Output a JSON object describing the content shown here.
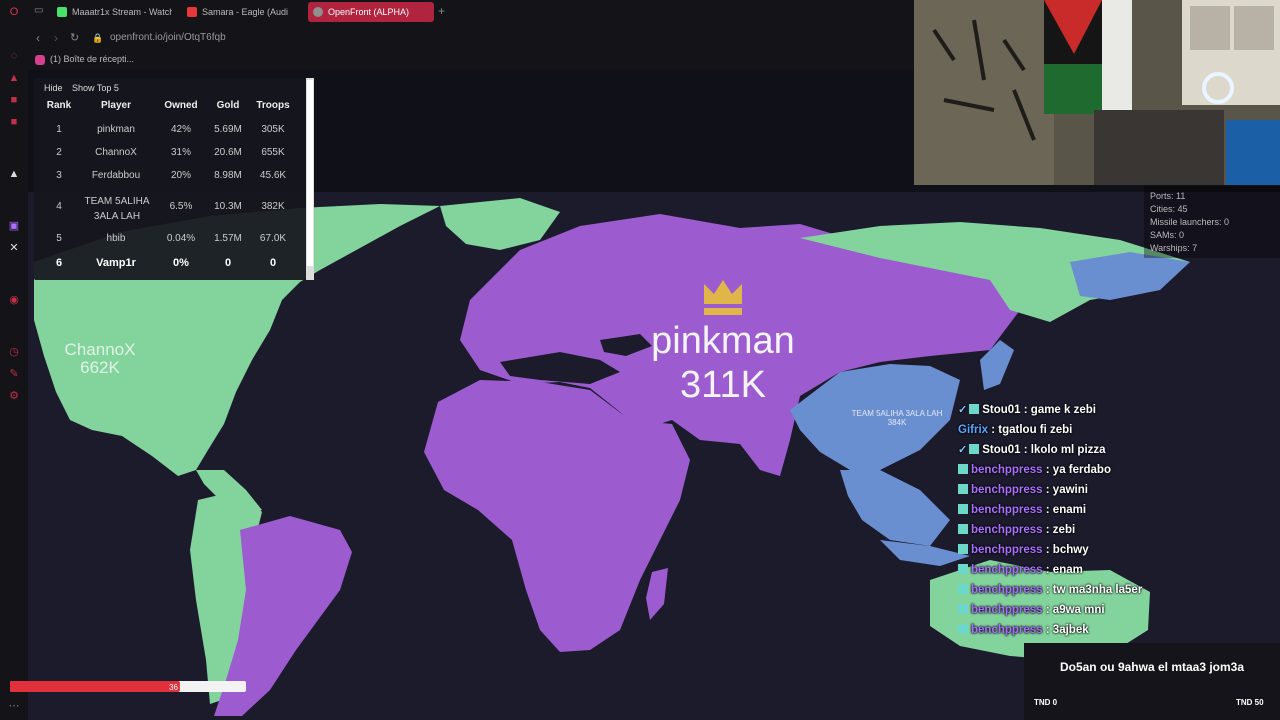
{
  "browser": {
    "tabs": [
      {
        "label": "Maaatr1x Stream - Watch",
        "icon_color": "#46e26a"
      },
      {
        "label": "Samara - Eagle (Audi",
        "icon_color": "#e53939"
      },
      {
        "label": "OpenFront (ALPHA)",
        "icon_color": "#8f8f8f"
      }
    ],
    "url": "openfront.io/join/OtqT6fqb",
    "bookmark": "(1) Boîte de récepti..."
  },
  "leaderboard": {
    "hide_label": "Hide",
    "show_top_label": "Show Top 5",
    "columns": [
      "Rank",
      "Player",
      "Owned",
      "Gold",
      "Troops"
    ],
    "rows": [
      {
        "rank": "1",
        "player": "pinkman",
        "owned": "42%",
        "gold": "5.69M",
        "troops": "305K"
      },
      {
        "rank": "2",
        "player": "ChannoX",
        "owned": "31%",
        "gold": "20.6M",
        "troops": "655K"
      },
      {
        "rank": "3",
        "player": "Ferdabbou",
        "owned": "20%",
        "gold": "8.98M",
        "troops": "45.6K"
      },
      {
        "rank": "4",
        "player": "TEAM 5ALIHA 3ALA LAH",
        "owned": "6.5%",
        "gold": "10.3M",
        "troops": "382K"
      },
      {
        "rank": "5",
        "player": "hbib",
        "owned": "0.04%",
        "gold": "1.57M",
        "troops": "67.0K"
      },
      {
        "rank": "6",
        "player": "Vamp1r",
        "owned": "0%",
        "gold": "0",
        "troops": "0"
      }
    ]
  },
  "map": {
    "leader_name": "pinkman",
    "leader_troops": "311K",
    "channox_name": "ChannoX",
    "channox_troops": "662K",
    "team_name": "TEAM 5ALIHA 3ALA LAH",
    "team_troops": "384K",
    "colors": {
      "purple": "#9c5cd0",
      "green": "#83d39d",
      "blue": "#6a8fd1",
      "ocean": "#1c1b2c"
    }
  },
  "stats": {
    "ports": "Ports: 11",
    "cities": "Cities: 45",
    "missile_launchers": "Missile launchers: 0",
    "sams": "SAMs: 0",
    "warships": "Warships: 7"
  },
  "chat": [
    {
      "user": "Stou01",
      "msg": ": game k zebi",
      "color": "#e9e9e9",
      "badges": 2
    },
    {
      "user": "Gifrix",
      "msg": ": tgatlou fi zebi",
      "color": "#58a6ff",
      "badges": 0
    },
    {
      "user": "Stou01",
      "msg": ": lkolo ml pizza",
      "color": "#e9e9e9",
      "badges": 2
    },
    {
      "user": "benchppress",
      "msg": ": ya ferdabo",
      "color": "#a970ff",
      "badges": 1
    },
    {
      "user": "benchppress",
      "msg": ": yawini",
      "color": "#a970ff",
      "badges": 1
    },
    {
      "user": "benchppress",
      "msg": ": enami",
      "color": "#a970ff",
      "badges": 1
    },
    {
      "user": "benchppress",
      "msg": ": zebi",
      "color": "#a970ff",
      "badges": 1
    },
    {
      "user": "benchppress",
      "msg": ": bchwy",
      "color": "#a970ff",
      "badges": 1
    },
    {
      "user": "benchppress",
      "msg": ": enam",
      "color": "#a970ff",
      "badges": 1
    },
    {
      "user": "benchppress",
      "msg": ": tw ma3nha la5er",
      "color": "#a970ff",
      "badges": 1
    },
    {
      "user": "benchppress",
      "msg": ": a9wa mni",
      "color": "#a970ff",
      "badges": 1
    },
    {
      "user": "benchppress",
      "msg": ": 3ajbek",
      "color": "#a970ff",
      "badges": 1
    }
  ],
  "goal": {
    "title": "Do5an ou 9ahwa el mtaa3 jom3a",
    "current": "36",
    "progress": 0.72,
    "min_label": "TND 0",
    "max_label": "TND 50"
  }
}
